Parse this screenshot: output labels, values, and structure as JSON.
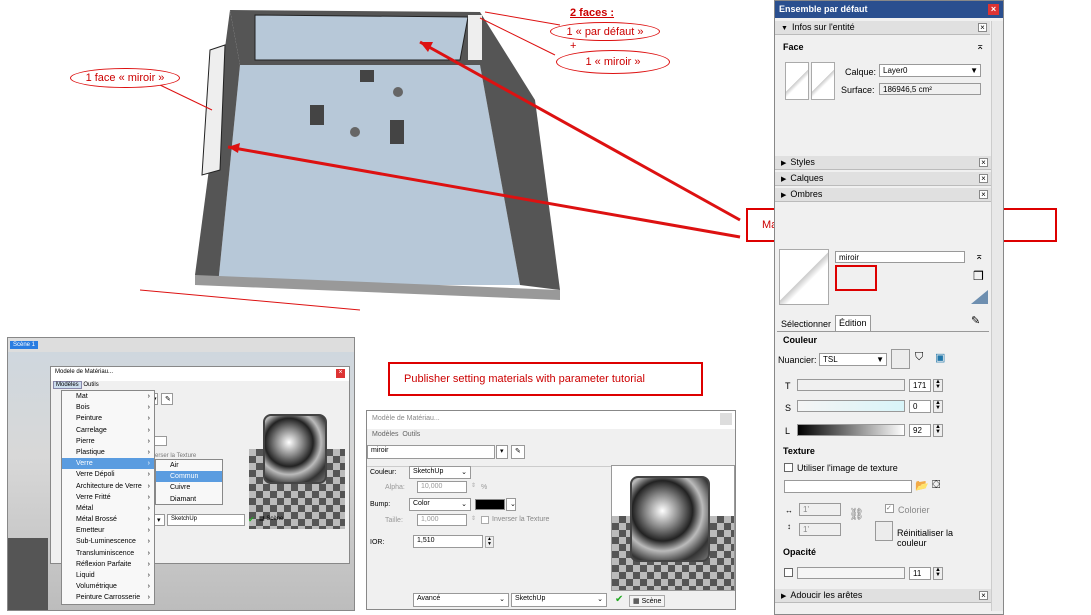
{
  "callouts": {
    "one_face_miroir": "1 face « miroir »",
    "two_faces": "2 faces :",
    "one_defaut": "1 « par défaut »",
    "plus": "+",
    "one_miroir": "1 « miroir »",
    "material_created": "Material “miroir” created with parameter tutorial",
    "publisher_setting": "Publisher setting materials with parameter tutorial"
  },
  "tray": {
    "title": "Ensemble par défaut",
    "entity_info": "Infos sur l'entité",
    "face_label": "Face",
    "calque_label": "Calque:",
    "calque_value": "Layer0",
    "surface_label": "Surface:",
    "surface_value": "186946,5 cm²",
    "sections": [
      "Styles",
      "Calques",
      "Ombres"
    ],
    "material_name": "miroir",
    "tab_select": "Sélectionner",
    "tab_edit": "Édition",
    "couleur": "Couleur",
    "nuancier_label": "Nuancier:",
    "nuancier_value": "TSL",
    "t_label": "T",
    "t_value": "171",
    "s_label": "S",
    "s_value": "0",
    "l_label": "L",
    "l_value": "92",
    "texture": "Texture",
    "use_texture": "Utiliser l'image de texture",
    "w_value": "1'",
    "h_value": "1'",
    "colorier": "Colorier",
    "reset": "Réinitialiser la couleur",
    "opacite": "Opacité",
    "opacity_value": "11",
    "adoucir": "Adoucir les arêtes"
  },
  "scene_tab": "Scène 1",
  "small_window": {
    "title": "Modele de Matériau...",
    "menu_models": "Modèles",
    "menu_tools": "Outils",
    "items": [
      "Mat",
      "Bois",
      "Peinture",
      "Carrelage",
      "Pierre",
      "Plastique",
      "Verre",
      "Verre Dépoli",
      "Architecture de Verre",
      "Verre Fritté",
      "Métal",
      "Métal Brossé",
      "Emetteur",
      "Sub-Luminescence",
      "Transluminiscence",
      "Réflexion Parfaite",
      "Liquid",
      "Volumétrique",
      "Peinture Carrosserie"
    ],
    "submenu": [
      "Air",
      "Commun",
      "Cuivre",
      "Diamant"
    ],
    "invert_fragment": "verser la Texture",
    "sketchup": "SketchUp",
    "scene_btn": "Scène"
  },
  "big_window": {
    "title": "Modèle de Matériau...",
    "menu_models": "Modèles",
    "menu_tools": "Outils",
    "name_value": "miroir",
    "couleur_label": "Couleur:",
    "couleur_value": "SketchUp",
    "alpha_label": "Alpha:",
    "alpha_value": "10,000",
    "alpha_unit": "%",
    "bump_label": "Bump:",
    "bump_value": "Color",
    "taille_label": "Taille:",
    "taille_value": "1,000",
    "invert": "Inverser la Texture",
    "ior_label": "IOR:",
    "ior_value": "1,510",
    "avance": "Avancé",
    "sketchup": "SketchUp",
    "scene_btn": "Scène"
  }
}
